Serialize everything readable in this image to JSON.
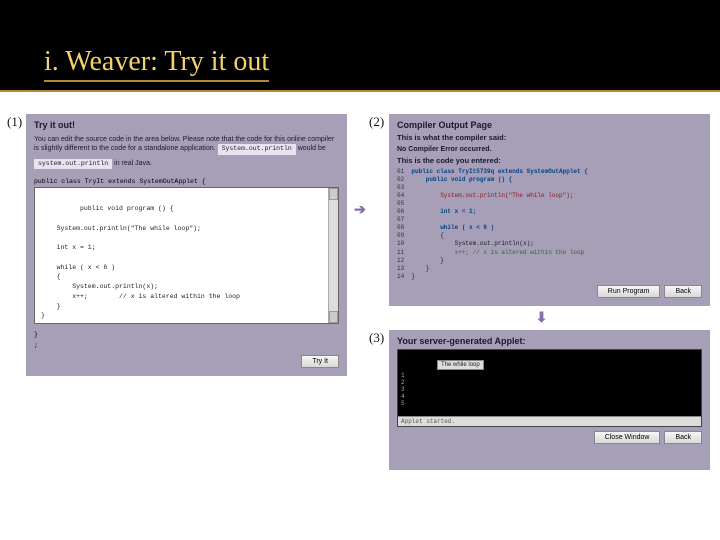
{
  "title": "i. Weaver: Try it out",
  "panel1": {
    "num": "(1)",
    "heading": "Try it out!",
    "intro_a": "You can edit the source code in the area below. Please note that the code for this online compiler is slightly different to the code for a standalone application.",
    "chip1": "System.out.println",
    "intro_b": " would be",
    "chip2": "system.out.println",
    "intro_c": " in real Java.",
    "pre_header": "public class TryIt extends SystemOutApplet {",
    "code": "public void program () {\n\n    System.out.println(\"The while loop\");\n\n    int x = 1;\n\n    while ( x < 6 )\n    {\n        System.out.println(x);\n        x++;        // x is altered within the loop\n    }\n}",
    "post_footer": "}\n;",
    "try_btn": "Try It"
  },
  "panel2": {
    "num": "(2)",
    "heading": "Compiler Output Page",
    "sub1": "This is what the compiler said:",
    "compiler_msg": "No Compiler Error occurred.",
    "sub2": "This is the code you entered:",
    "run_btn": "Run Program",
    "back_btn": "Back"
  },
  "panel3": {
    "num": "(3)",
    "heading": "Your server-generated Applet:",
    "applet_title": "The while loop",
    "applet_out": "1\n2\n3\n4\n5",
    "status": "Applet started.",
    "close_btn": "Close Window",
    "back_btn": "Back"
  },
  "code_listing": [
    {
      "n": "01",
      "t": "public class TryIt5739q extends SystemOutApplet {",
      "cls": "kw"
    },
    {
      "n": "02",
      "t": "    public void program () {",
      "cls": "kw"
    },
    {
      "n": "03",
      "t": "",
      "cls": ""
    },
    {
      "n": "04",
      "t": "        System.out.println(\"The while loop\");",
      "cls": "str"
    },
    {
      "n": "05",
      "t": "",
      "cls": ""
    },
    {
      "n": "06",
      "t": "        int x = 1;",
      "cls": "kw"
    },
    {
      "n": "07",
      "t": "",
      "cls": ""
    },
    {
      "n": "08",
      "t": "        while ( x < 6 )",
      "cls": "kw"
    },
    {
      "n": "09",
      "t": "        {",
      "cls": ""
    },
    {
      "n": "10",
      "t": "            System.out.println(x);",
      "cls": ""
    },
    {
      "n": "11",
      "t": "            x++; // x is altered within the loop",
      "cls": "cmt"
    },
    {
      "n": "12",
      "t": "        }",
      "cls": ""
    },
    {
      "n": "13",
      "t": "    }",
      "cls": ""
    },
    {
      "n": "14",
      "t": "}",
      "cls": ""
    }
  ]
}
